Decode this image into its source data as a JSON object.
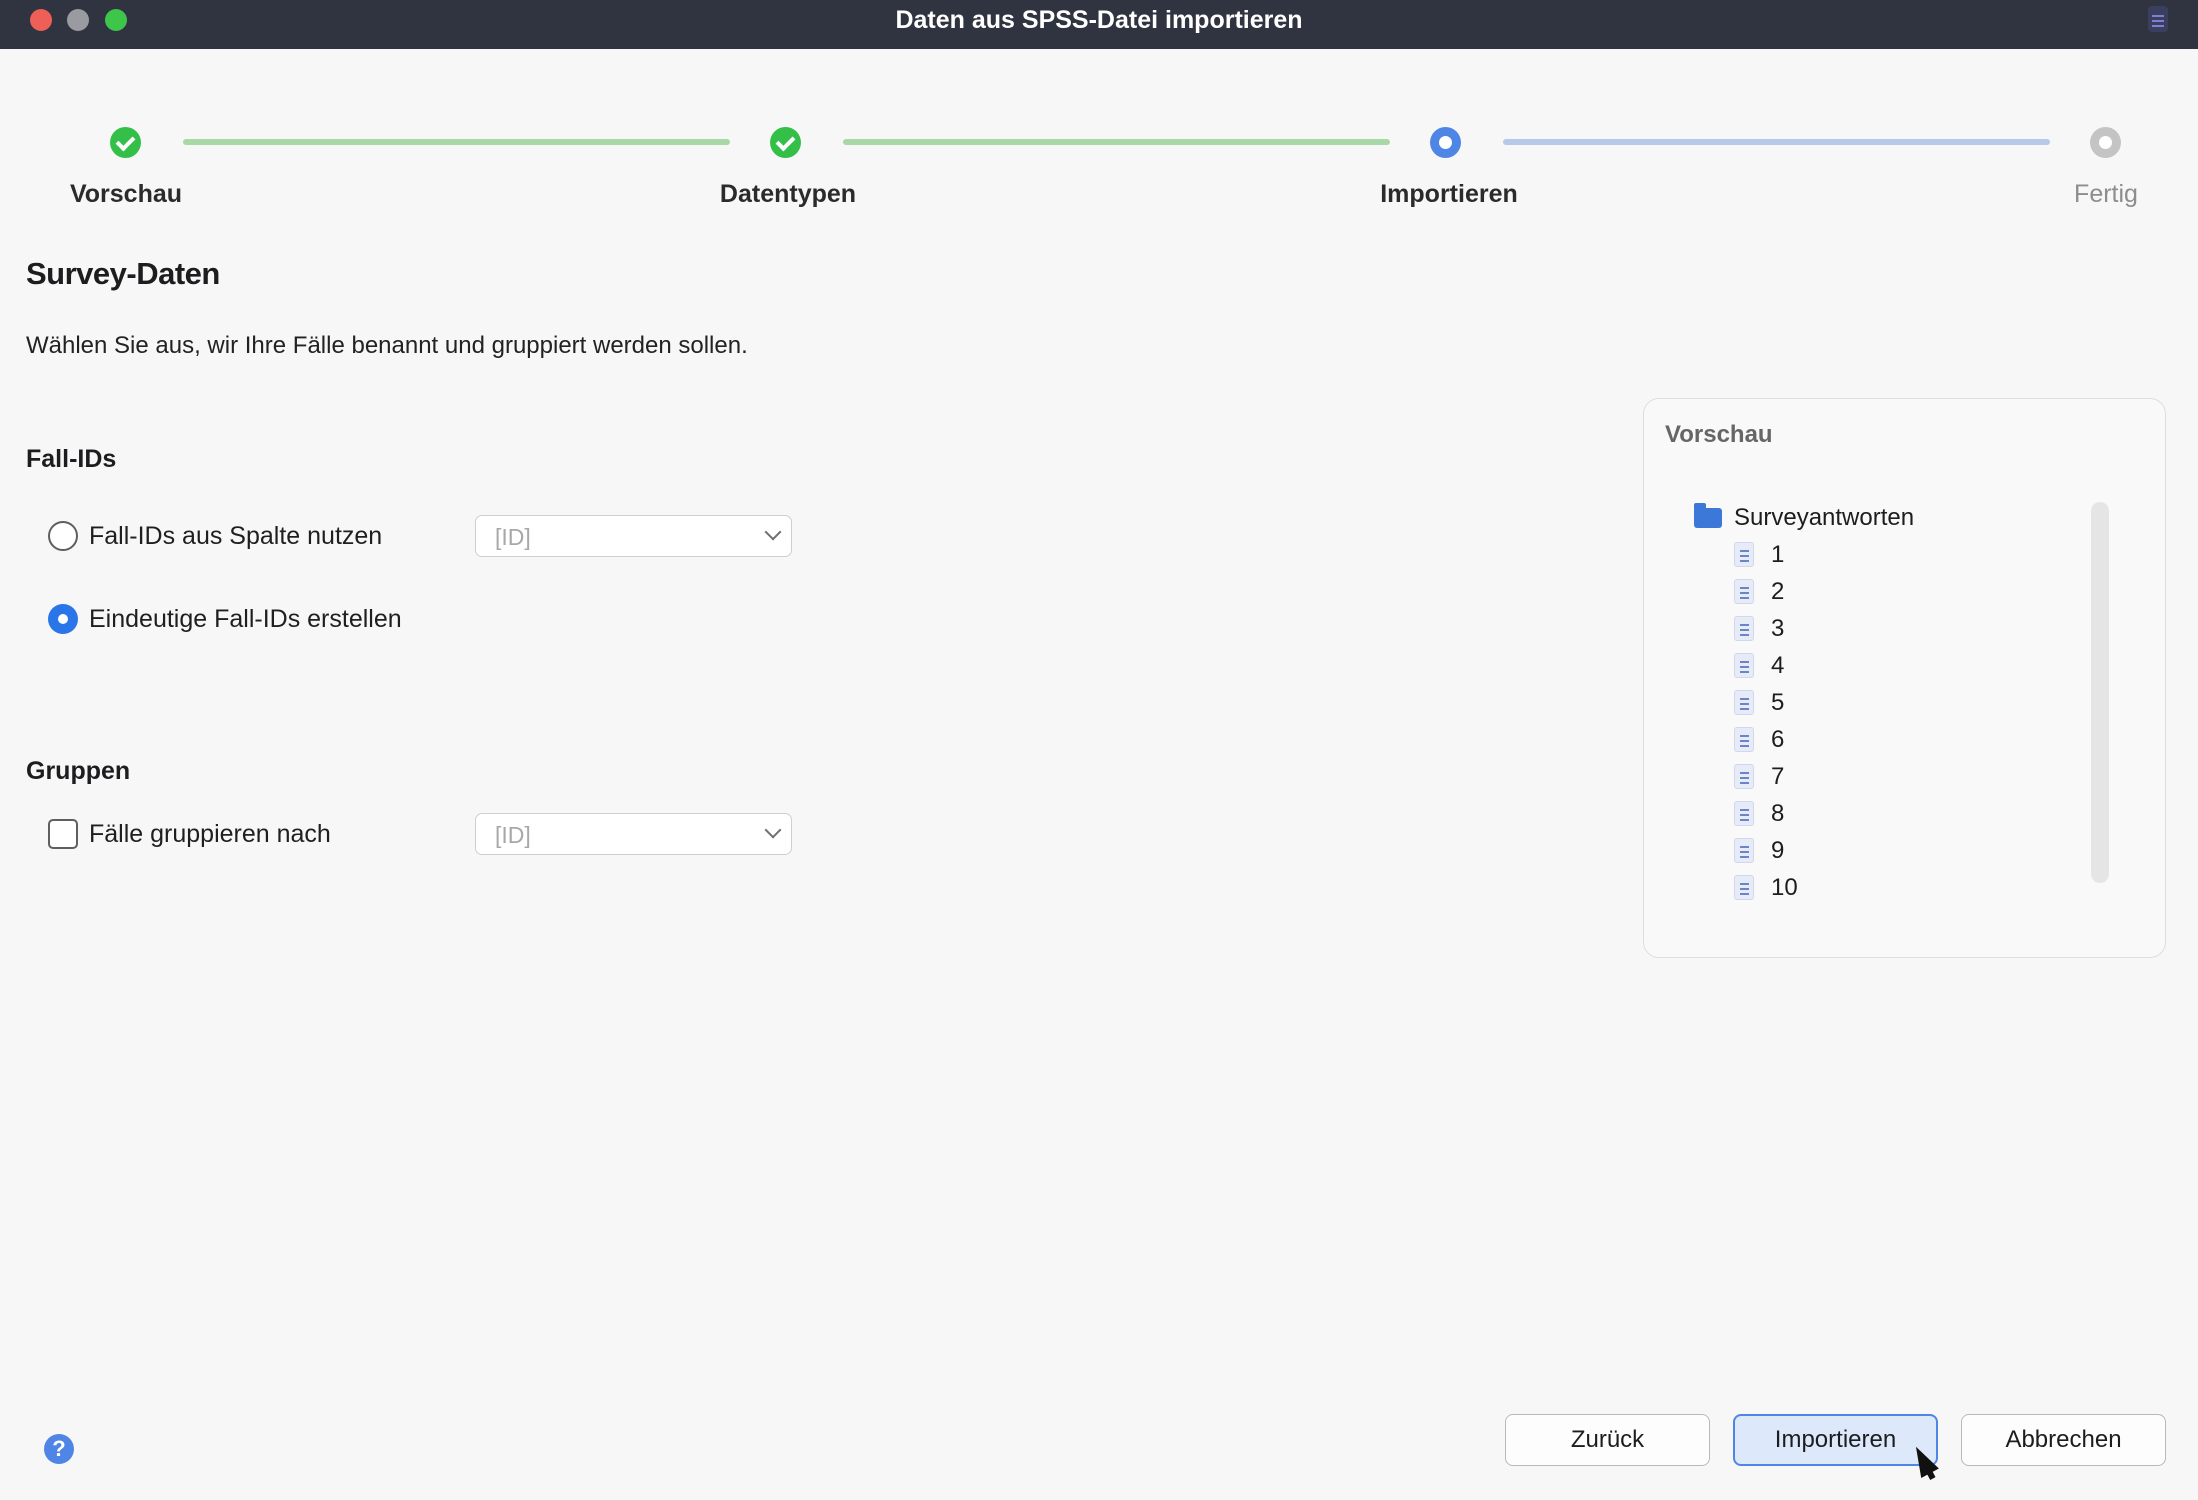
{
  "window": {
    "title": "Daten aus SPSS-Datei importieren"
  },
  "stepper": {
    "steps": [
      {
        "label": "Vorschau",
        "state": "done"
      },
      {
        "label": "Datentypen",
        "state": "done"
      },
      {
        "label": "Importieren",
        "state": "current"
      },
      {
        "label": "Fertig",
        "state": "future"
      }
    ]
  },
  "page": {
    "title": "Survey-Daten",
    "description": "Wählen Sie aus, wir Ihre Fälle benannt und gruppiert werden sollen."
  },
  "case_ids": {
    "title": "Fall-IDs",
    "option_column": {
      "label": "Fall-IDs aus Spalte nutzen",
      "checked": false,
      "select_value": "[ID]"
    },
    "option_unique": {
      "label": "Eindeutige Fall-IDs erstellen",
      "checked": true
    }
  },
  "groups": {
    "title": "Gruppen",
    "group_by": {
      "label": "Fälle gruppieren nach",
      "checked": false,
      "select_value": "[ID]"
    }
  },
  "preview": {
    "title": "Vorschau",
    "root": "Surveyantworten",
    "items": [
      "1",
      "2",
      "3",
      "4",
      "5",
      "6",
      "7",
      "8",
      "9",
      "10"
    ]
  },
  "buttons": {
    "back": "Zurück",
    "import": "Importieren",
    "cancel": "Abbrechen"
  },
  "icons": [
    "close-icon",
    "minimize-icon",
    "maximize-icon",
    "app-menu-icon",
    "check-icon",
    "folder-icon",
    "document-icon",
    "help-icon",
    "chevron-down-icon",
    "cursor-icon"
  ],
  "colors": {
    "accent": "#4f86e6",
    "done": "#34c048",
    "titlebar": "#2f3440"
  }
}
